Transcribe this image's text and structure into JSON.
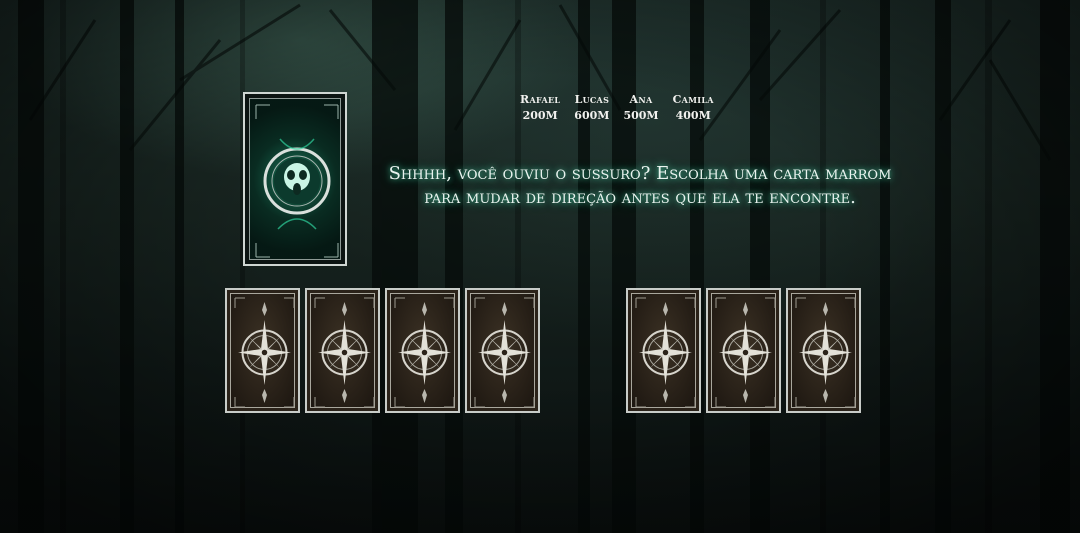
{
  "players": [
    {
      "name": "Rafael",
      "distance": "200M"
    },
    {
      "name": "Lucas",
      "distance": "600M"
    },
    {
      "name": "Ana",
      "distance": "500M"
    },
    {
      "name": "Camila",
      "distance": "400M"
    }
  ],
  "message": "Shhhh, você ouviu o sussuro? Escolha uma carta marrom para mudar de direção antes que ela te encontre.",
  "deck": {
    "icon": "skull-icon"
  },
  "choice_cards": {
    "count": 7,
    "icon": "compass-rose-icon"
  },
  "colors": {
    "glow": "#50ffc8",
    "card_brown": "#2a2219",
    "deck_green": "#1ea878"
  }
}
